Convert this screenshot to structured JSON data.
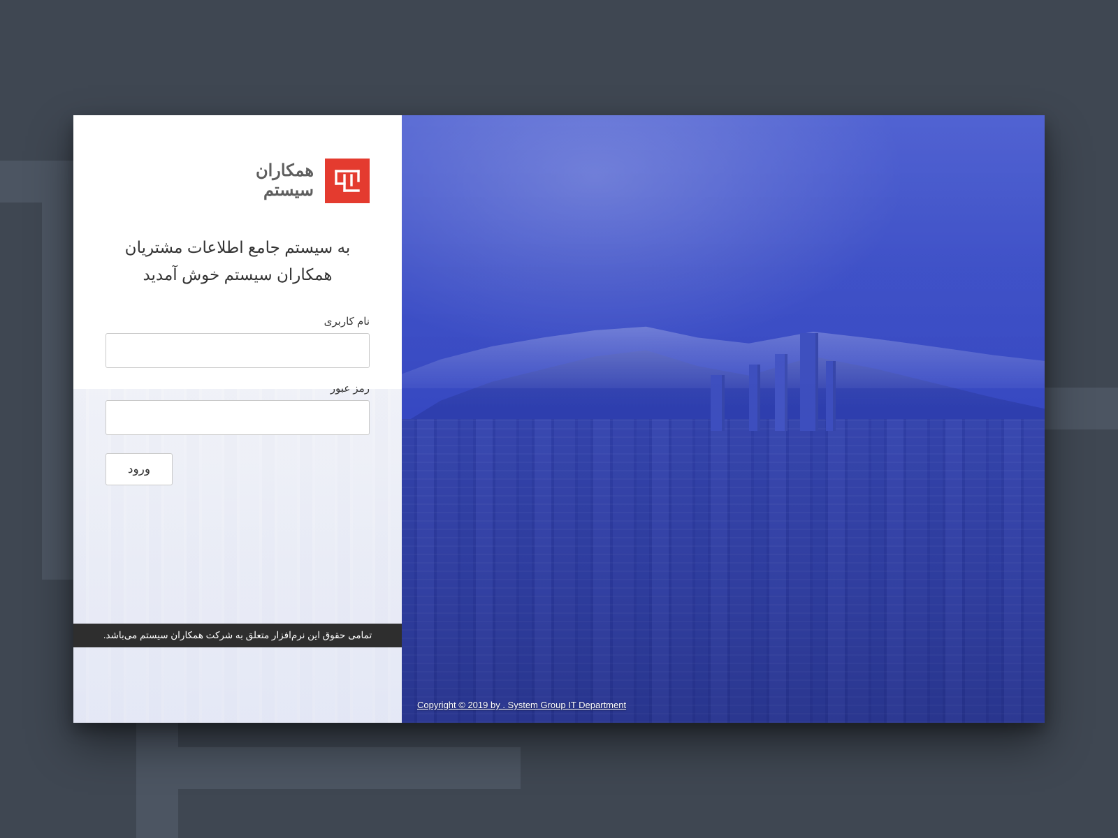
{
  "brand": {
    "line1": "همکاران",
    "line2": "سیستم",
    "logo_color": "#e43b2f"
  },
  "welcome": {
    "line1": "به سیستم جامع اطلاعات مشتریان",
    "line2": "همکاران سیستم خوش آمدید"
  },
  "form": {
    "username_label": "نام کاربری",
    "username_value": "",
    "password_label": "رمز عبور",
    "password_value": "",
    "submit_label": "ورود"
  },
  "rights_notice": "تمامی حقوق این نرم‌افزار متعلق به شرکت همکاران سیستم می‌باشد.",
  "copyright": "Copyright © 2019 by . System Group IT Department"
}
